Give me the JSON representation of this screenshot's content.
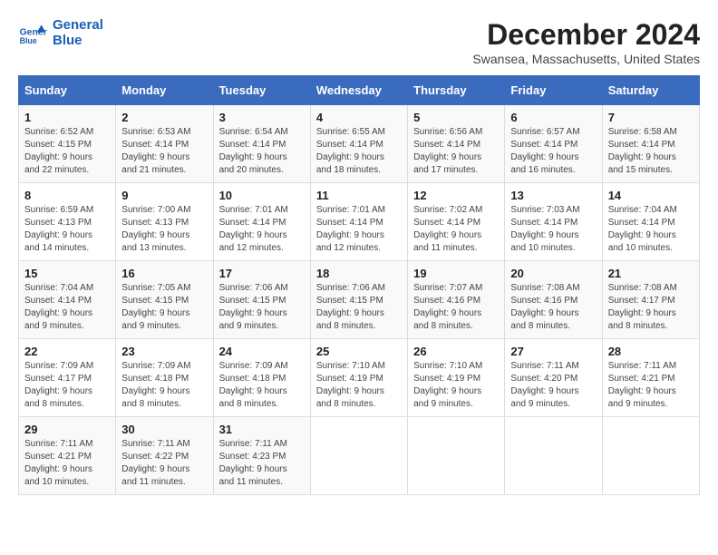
{
  "logo": {
    "line1": "General",
    "line2": "Blue"
  },
  "title": "December 2024",
  "subtitle": "Swansea, Massachusetts, United States",
  "days_of_week": [
    "Sunday",
    "Monday",
    "Tuesday",
    "Wednesday",
    "Thursday",
    "Friday",
    "Saturday"
  ],
  "weeks": [
    [
      {
        "day": "1",
        "sunrise": "6:52 AM",
        "sunset": "4:15 PM",
        "daylight": "9 hours and 22 minutes."
      },
      {
        "day": "2",
        "sunrise": "6:53 AM",
        "sunset": "4:14 PM",
        "daylight": "9 hours and 21 minutes."
      },
      {
        "day": "3",
        "sunrise": "6:54 AM",
        "sunset": "4:14 PM",
        "daylight": "9 hours and 20 minutes."
      },
      {
        "day": "4",
        "sunrise": "6:55 AM",
        "sunset": "4:14 PM",
        "daylight": "9 hours and 18 minutes."
      },
      {
        "day": "5",
        "sunrise": "6:56 AM",
        "sunset": "4:14 PM",
        "daylight": "9 hours and 17 minutes."
      },
      {
        "day": "6",
        "sunrise": "6:57 AM",
        "sunset": "4:14 PM",
        "daylight": "9 hours and 16 minutes."
      },
      {
        "day": "7",
        "sunrise": "6:58 AM",
        "sunset": "4:14 PM",
        "daylight": "9 hours and 15 minutes."
      }
    ],
    [
      {
        "day": "8",
        "sunrise": "6:59 AM",
        "sunset": "4:13 PM",
        "daylight": "9 hours and 14 minutes."
      },
      {
        "day": "9",
        "sunrise": "7:00 AM",
        "sunset": "4:13 PM",
        "daylight": "9 hours and 13 minutes."
      },
      {
        "day": "10",
        "sunrise": "7:01 AM",
        "sunset": "4:14 PM",
        "daylight": "9 hours and 12 minutes."
      },
      {
        "day": "11",
        "sunrise": "7:01 AM",
        "sunset": "4:14 PM",
        "daylight": "9 hours and 12 minutes."
      },
      {
        "day": "12",
        "sunrise": "7:02 AM",
        "sunset": "4:14 PM",
        "daylight": "9 hours and 11 minutes."
      },
      {
        "day": "13",
        "sunrise": "7:03 AM",
        "sunset": "4:14 PM",
        "daylight": "9 hours and 10 minutes."
      },
      {
        "day": "14",
        "sunrise": "7:04 AM",
        "sunset": "4:14 PM",
        "daylight": "9 hours and 10 minutes."
      }
    ],
    [
      {
        "day": "15",
        "sunrise": "7:04 AM",
        "sunset": "4:14 PM",
        "daylight": "9 hours and 9 minutes."
      },
      {
        "day": "16",
        "sunrise": "7:05 AM",
        "sunset": "4:15 PM",
        "daylight": "9 hours and 9 minutes."
      },
      {
        "day": "17",
        "sunrise": "7:06 AM",
        "sunset": "4:15 PM",
        "daylight": "9 hours and 9 minutes."
      },
      {
        "day": "18",
        "sunrise": "7:06 AM",
        "sunset": "4:15 PM",
        "daylight": "9 hours and 8 minutes."
      },
      {
        "day": "19",
        "sunrise": "7:07 AM",
        "sunset": "4:16 PM",
        "daylight": "9 hours and 8 minutes."
      },
      {
        "day": "20",
        "sunrise": "7:08 AM",
        "sunset": "4:16 PM",
        "daylight": "9 hours and 8 minutes."
      },
      {
        "day": "21",
        "sunrise": "7:08 AM",
        "sunset": "4:17 PM",
        "daylight": "9 hours and 8 minutes."
      }
    ],
    [
      {
        "day": "22",
        "sunrise": "7:09 AM",
        "sunset": "4:17 PM",
        "daylight": "9 hours and 8 minutes."
      },
      {
        "day": "23",
        "sunrise": "7:09 AM",
        "sunset": "4:18 PM",
        "daylight": "9 hours and 8 minutes."
      },
      {
        "day": "24",
        "sunrise": "7:09 AM",
        "sunset": "4:18 PM",
        "daylight": "9 hours and 8 minutes."
      },
      {
        "day": "25",
        "sunrise": "7:10 AM",
        "sunset": "4:19 PM",
        "daylight": "9 hours and 8 minutes."
      },
      {
        "day": "26",
        "sunrise": "7:10 AM",
        "sunset": "4:19 PM",
        "daylight": "9 hours and 9 minutes."
      },
      {
        "day": "27",
        "sunrise": "7:11 AM",
        "sunset": "4:20 PM",
        "daylight": "9 hours and 9 minutes."
      },
      {
        "day": "28",
        "sunrise": "7:11 AM",
        "sunset": "4:21 PM",
        "daylight": "9 hours and 9 minutes."
      }
    ],
    [
      {
        "day": "29",
        "sunrise": "7:11 AM",
        "sunset": "4:21 PM",
        "daylight": "9 hours and 10 minutes."
      },
      {
        "day": "30",
        "sunrise": "7:11 AM",
        "sunset": "4:22 PM",
        "daylight": "9 hours and 11 minutes."
      },
      {
        "day": "31",
        "sunrise": "7:11 AM",
        "sunset": "4:23 PM",
        "daylight": "9 hours and 11 minutes."
      },
      null,
      null,
      null,
      null
    ]
  ]
}
